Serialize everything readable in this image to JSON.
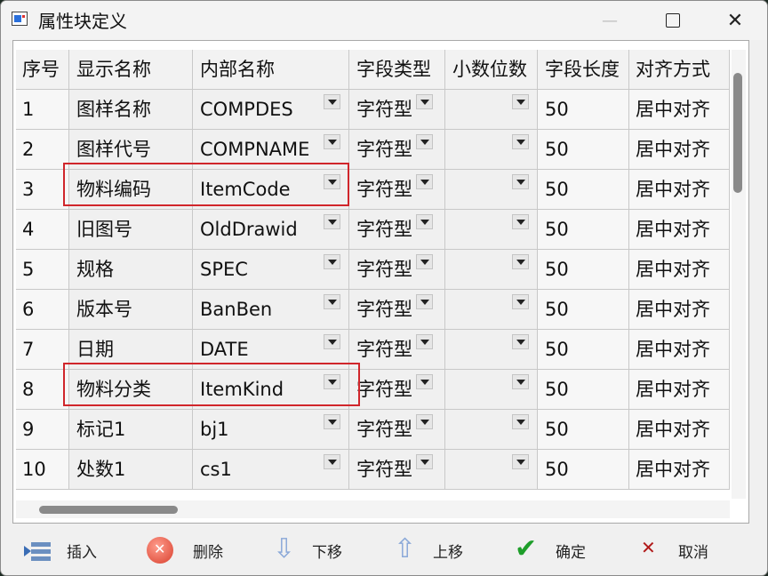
{
  "window": {
    "title": "属性块定义"
  },
  "table": {
    "headers": [
      "序号",
      "显示名称",
      "内部名称",
      "字段类型",
      "小数位数",
      "字段长度",
      "对齐方式"
    ],
    "rows": [
      [
        "1",
        "图样名称",
        "COMPDES",
        "字符型",
        "",
        "50",
        "居中对齐"
      ],
      [
        "2",
        "图样代号",
        "COMPNAME",
        "字符型",
        "",
        "50",
        "居中对齐"
      ],
      [
        "3",
        "物料编码",
        "ItemCode",
        "字符型",
        "",
        "50",
        "居中对齐"
      ],
      [
        "4",
        "旧图号",
        "OldDrawid",
        "字符型",
        "",
        "50",
        "居中对齐"
      ],
      [
        "5",
        "规格",
        "SPEC",
        "字符型",
        "",
        "50",
        "居中对齐"
      ],
      [
        "6",
        "版本号",
        "BanBen",
        "字符型",
        "",
        "50",
        "居中对齐"
      ],
      [
        "7",
        "日期",
        "DATE",
        "字符型",
        "",
        "50",
        "居中对齐"
      ],
      [
        "8",
        "物料分类",
        "ItemKind",
        "字符型",
        "",
        "50",
        "居中对齐"
      ],
      [
        "9",
        "标记1",
        "bj1",
        "字符型",
        "",
        "50",
        "居中对齐"
      ],
      [
        "10",
        "处数1",
        "cs1",
        "字符型",
        "",
        "50",
        "居中对齐"
      ]
    ],
    "highlighted_rows": [
      "3",
      "8"
    ]
  },
  "toolbar": {
    "insert": "插入",
    "delete": "删除",
    "move_down": "下移",
    "move_up": "上移",
    "ok": "确定",
    "cancel": "取消"
  },
  "colors": {
    "highlight": "#d0262b",
    "ok_icon": "#1e9e2a",
    "cancel_icon": "#b11a1a"
  }
}
